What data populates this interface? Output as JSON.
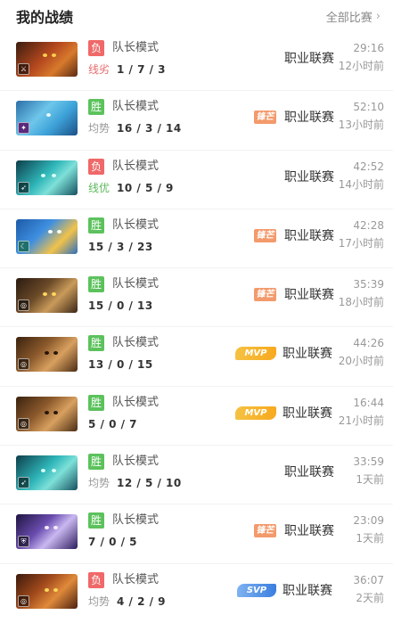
{
  "header": {
    "title": "我的战绩",
    "all_matches_label": "全部比赛",
    "chevron": "›"
  },
  "colors": {
    "win": "#5cc25c",
    "lose": "#f06868",
    "lane_good": "#5cb85c",
    "lane_bad": "#e86a6a"
  },
  "matches": [
    {
      "result": "负",
      "mode": "队长模式",
      "lane": "线劣",
      "kda": "1 / 7 / 3",
      "tag": "",
      "league": "职业联赛",
      "duration": "29:16",
      "ago": "12小时前",
      "hero_icon": "hero-portrait-icon",
      "role_icon": "role-icon"
    },
    {
      "result": "胜",
      "mode": "队长模式",
      "lane": "均势",
      "kda": "16 / 3 / 14",
      "tag": "锋芒",
      "league": "职业联赛",
      "duration": "52:10",
      "ago": "13小时前",
      "hero_icon": "hero-portrait-icon",
      "role_icon": "role-icon"
    },
    {
      "result": "负",
      "mode": "队长模式",
      "lane": "线优",
      "kda": "10 / 5 / 9",
      "tag": "",
      "league": "职业联赛",
      "duration": "42:52",
      "ago": "14小时前",
      "hero_icon": "hero-portrait-icon",
      "role_icon": "role-icon"
    },
    {
      "result": "胜",
      "mode": "队长模式",
      "lane": "",
      "kda": "15 / 3 / 23",
      "tag": "锋芒",
      "league": "职业联赛",
      "duration": "42:28",
      "ago": "17小时前",
      "hero_icon": "hero-portrait-icon",
      "role_icon": "role-icon"
    },
    {
      "result": "胜",
      "mode": "队长模式",
      "lane": "",
      "kda": "15 / 0 / 13",
      "tag": "锋芒",
      "league": "职业联赛",
      "duration": "35:39",
      "ago": "18小时前",
      "hero_icon": "hero-portrait-icon",
      "role_icon": "role-icon"
    },
    {
      "result": "胜",
      "mode": "队长模式",
      "lane": "",
      "kda": "13 / 0 / 15",
      "tag": "MVP",
      "league": "职业联赛",
      "duration": "44:26",
      "ago": "20小时前",
      "hero_icon": "hero-portrait-icon",
      "role_icon": "role-icon"
    },
    {
      "result": "胜",
      "mode": "队长模式",
      "lane": "",
      "kda": "5 / 0 / 7",
      "tag": "MVP",
      "league": "职业联赛",
      "duration": "16:44",
      "ago": "21小时前",
      "hero_icon": "hero-portrait-icon",
      "role_icon": "role-icon"
    },
    {
      "result": "胜",
      "mode": "队长模式",
      "lane": "均势",
      "kda": "12 / 5 / 10",
      "tag": "",
      "league": "职业联赛",
      "duration": "33:59",
      "ago": "1天前",
      "hero_icon": "hero-portrait-icon",
      "role_icon": "role-icon"
    },
    {
      "result": "胜",
      "mode": "队长模式",
      "lane": "",
      "kda": "7 / 0 / 5",
      "tag": "锋芒",
      "league": "职业联赛",
      "duration": "23:09",
      "ago": "1天前",
      "hero_icon": "hero-portrait-icon",
      "role_icon": "role-icon"
    },
    {
      "result": "负",
      "mode": "队长模式",
      "lane": "均势",
      "kda": "4 / 2 / 9",
      "tag": "SVP",
      "league": "职业联赛",
      "duration": "36:07",
      "ago": "2天前",
      "hero_icon": "hero-portrait-icon",
      "role_icon": "role-icon"
    }
  ]
}
